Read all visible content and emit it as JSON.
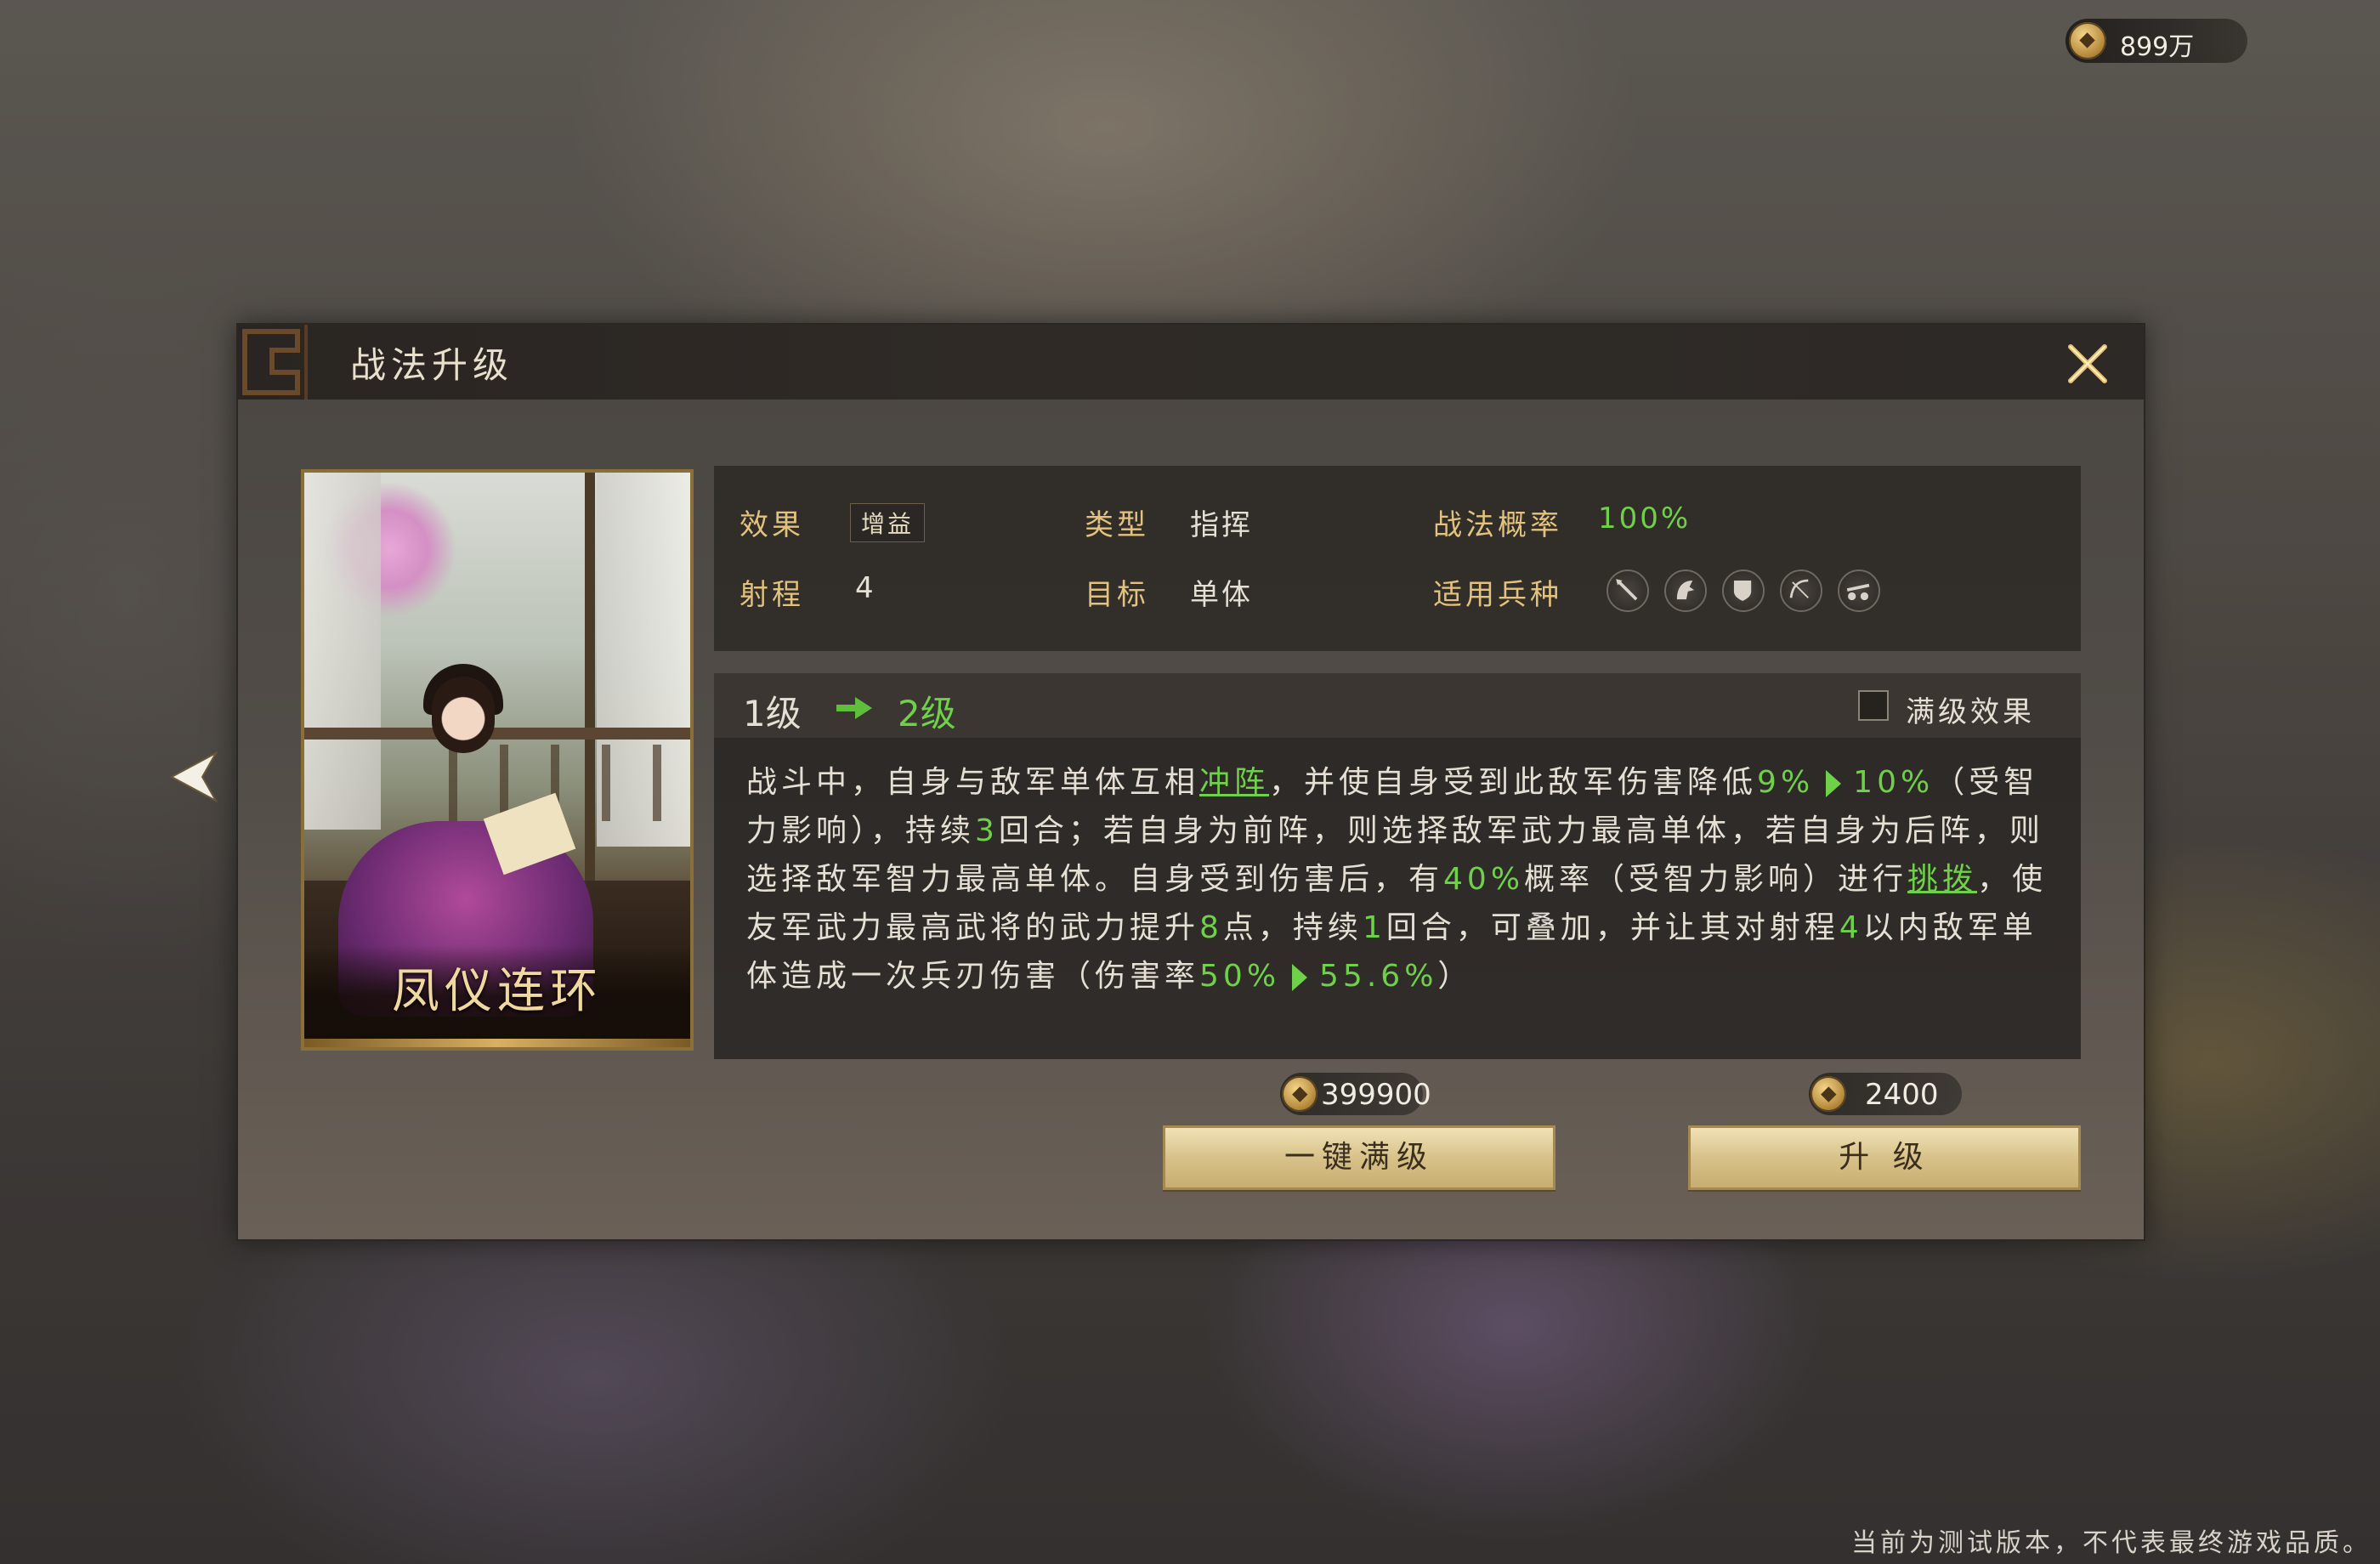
{
  "top_currency": {
    "icon": "coin-icon",
    "value": "899万"
  },
  "panel": {
    "title": "战法升级",
    "close_icon": "close-icon"
  },
  "skill_card": {
    "name": "凤仪连环"
  },
  "info": {
    "effect_label": "效果",
    "effect_tag": "增益",
    "type_label": "类型",
    "type_value": "指挥",
    "prob_label": "战法概率",
    "prob_value": "100%",
    "range_label": "射程",
    "range_value": "4",
    "target_label": "目标",
    "target_value": "单体",
    "troops_label": "适用兵种",
    "troop_icons": [
      "spear-icon",
      "cavalry-icon",
      "shield-icon",
      "bow-icon",
      "siege-icon"
    ]
  },
  "upgrade": {
    "from_level": "1级",
    "to_level": "2级",
    "max_effect_label": "满级效果",
    "description": {
      "p1": "战斗中，自身与敌军单体互相",
      "link1": "冲阵",
      "p2": "，并使自身受到此敌军伤害降低",
      "v1a": "9%",
      "v1b": "10%",
      "p3": "（受智力影响），持续",
      "v2": "3",
      "p4": "回合；若自身为前阵，则选择敌军武力最高单体，若自身为后阵，则选择敌军智力最高单体。自身受到伤害后，有",
      "v3": "40%",
      "p5": "概率（受智力影响）进行",
      "link2": "挑拨",
      "p6": "，使友军武力最高武将的武力提升",
      "v4": "8",
      "p7": "点，持续",
      "v5": "1",
      "p8": "回合，可叠加，并让其对射程",
      "v6": "4",
      "p9": "以内敌军单体造成一次兵刃伤害（伤害率",
      "v7a": "50%",
      "v7b": "55.6%",
      "p10": "）"
    }
  },
  "actions": {
    "max_cost": "399900",
    "max_label": "一键满级",
    "upgrade_cost": "2400",
    "upgrade_label": "升 级"
  },
  "footer": "当前为测试版本，不代表最终游戏品质。"
}
